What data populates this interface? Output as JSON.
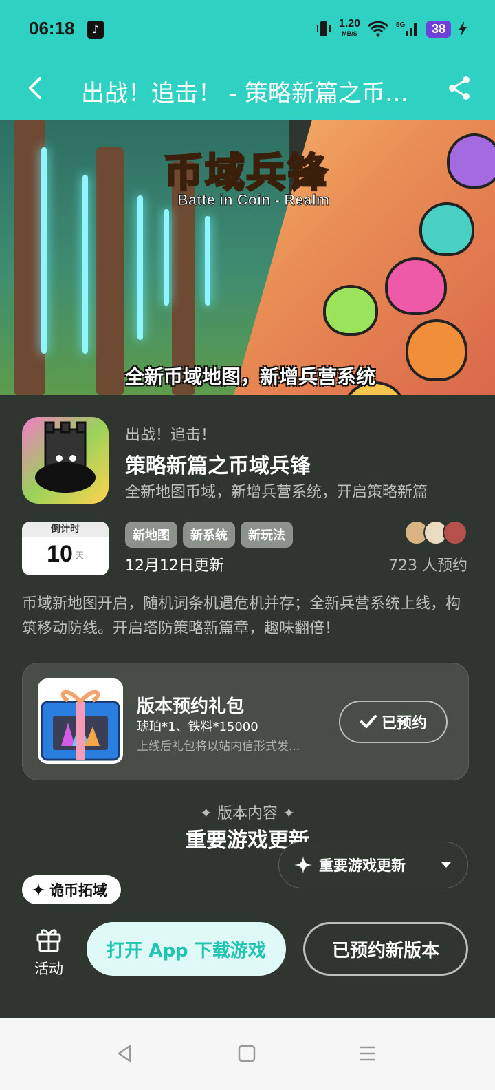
{
  "status_bar": {
    "time": "06:18",
    "net_speed": "1.20",
    "net_unit": "MB/S",
    "signal": "5G",
    "battery": "38"
  },
  "header": {
    "title": "出战！追击！ - 策略新篇之币域兵锋"
  },
  "banner": {
    "logo_cn": "币域兵锋",
    "logo_en": "Batte in Coin - Realm",
    "caption": "全新币域地图，新增兵营系统"
  },
  "app": {
    "subtitle": "出战！追击！",
    "name": "策略新篇之币域兵锋",
    "tagline": "全新地图币域，新增兵营系统，开启策略新篇"
  },
  "countdown": {
    "label": "倒计时",
    "value": "10",
    "unit": "天"
  },
  "tags": [
    "新地图",
    "新系统",
    "新玩法"
  ],
  "update_date": "12月12日更新",
  "reserve_count": "723 人预约",
  "intro": "币域新地图开启，随机词条机遇危机并存；全新兵营系统上线，构筑移动防线。开启塔防策略新篇章，趣味翻倍！",
  "gift": {
    "title": "版本预约礼包",
    "items": "琥珀*1、铁料*15000",
    "note": "上线后礼包将以站内信形式发...",
    "button": "已预约"
  },
  "section": {
    "label": "版本内容",
    "title": "重要游戏更新",
    "dropdown": "重要游戏更新",
    "chip": "诡币拓域"
  },
  "bottom": {
    "activity": "活动",
    "open_app": "打开 App 下载游戏",
    "reserved_new": "已预约新版本"
  },
  "colors": {
    "accent": "#2ed1c2",
    "background": "#2e362f"
  }
}
